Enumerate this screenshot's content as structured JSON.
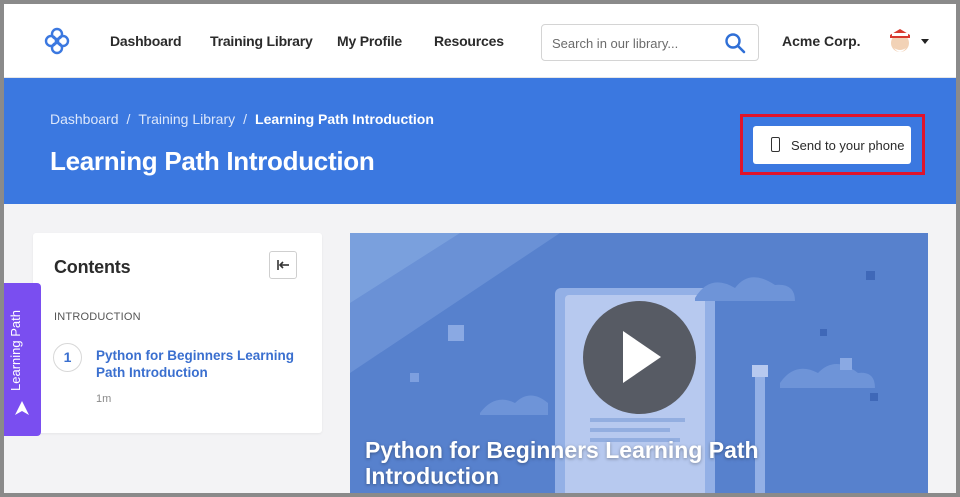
{
  "nav": {
    "links": [
      "Dashboard",
      "Training Library",
      "My Profile",
      "Resources"
    ],
    "search_placeholder": "Search in our library...",
    "org_name": "Acme Corp."
  },
  "hero": {
    "breadcrumb": [
      "Dashboard",
      "Training Library",
      "Learning Path Introduction"
    ],
    "title": "Learning Path Introduction",
    "send_button": "Send to your phone"
  },
  "side_tab": {
    "label": "Learning Path"
  },
  "contents": {
    "title": "Contents",
    "section": "INTRODUCTION",
    "items": [
      {
        "number": "1",
        "title": "Python for Beginners Learning Path Introduction",
        "duration": "1m"
      }
    ]
  },
  "video": {
    "title": "Python for Beginners Learning Path Introduction"
  },
  "colors": {
    "hero_bg": "#3b78e0",
    "accent_purple": "#7a4ef0",
    "highlight_red": "#e0132b",
    "link_blue": "#3a6fcf"
  }
}
